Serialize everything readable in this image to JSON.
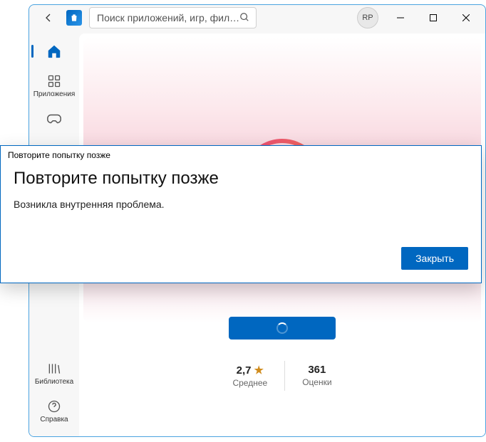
{
  "titlebar": {
    "search_placeholder": "Поиск приложений, игр, фил…",
    "avatar_initials": "RP"
  },
  "sidebar": {
    "home": "",
    "apps": "Приложения",
    "library": "Библиотека",
    "help": "Справка"
  },
  "stats": {
    "rating_value": "2,7",
    "rating_label": "Среднее",
    "reviews_value": "361",
    "reviews_label": "Оценки"
  },
  "dialog": {
    "title": "Повторите попытку позже",
    "heading": "Повторите попытку позже",
    "message": "Возникла внутренняя проблема.",
    "close": "Закрыть"
  }
}
